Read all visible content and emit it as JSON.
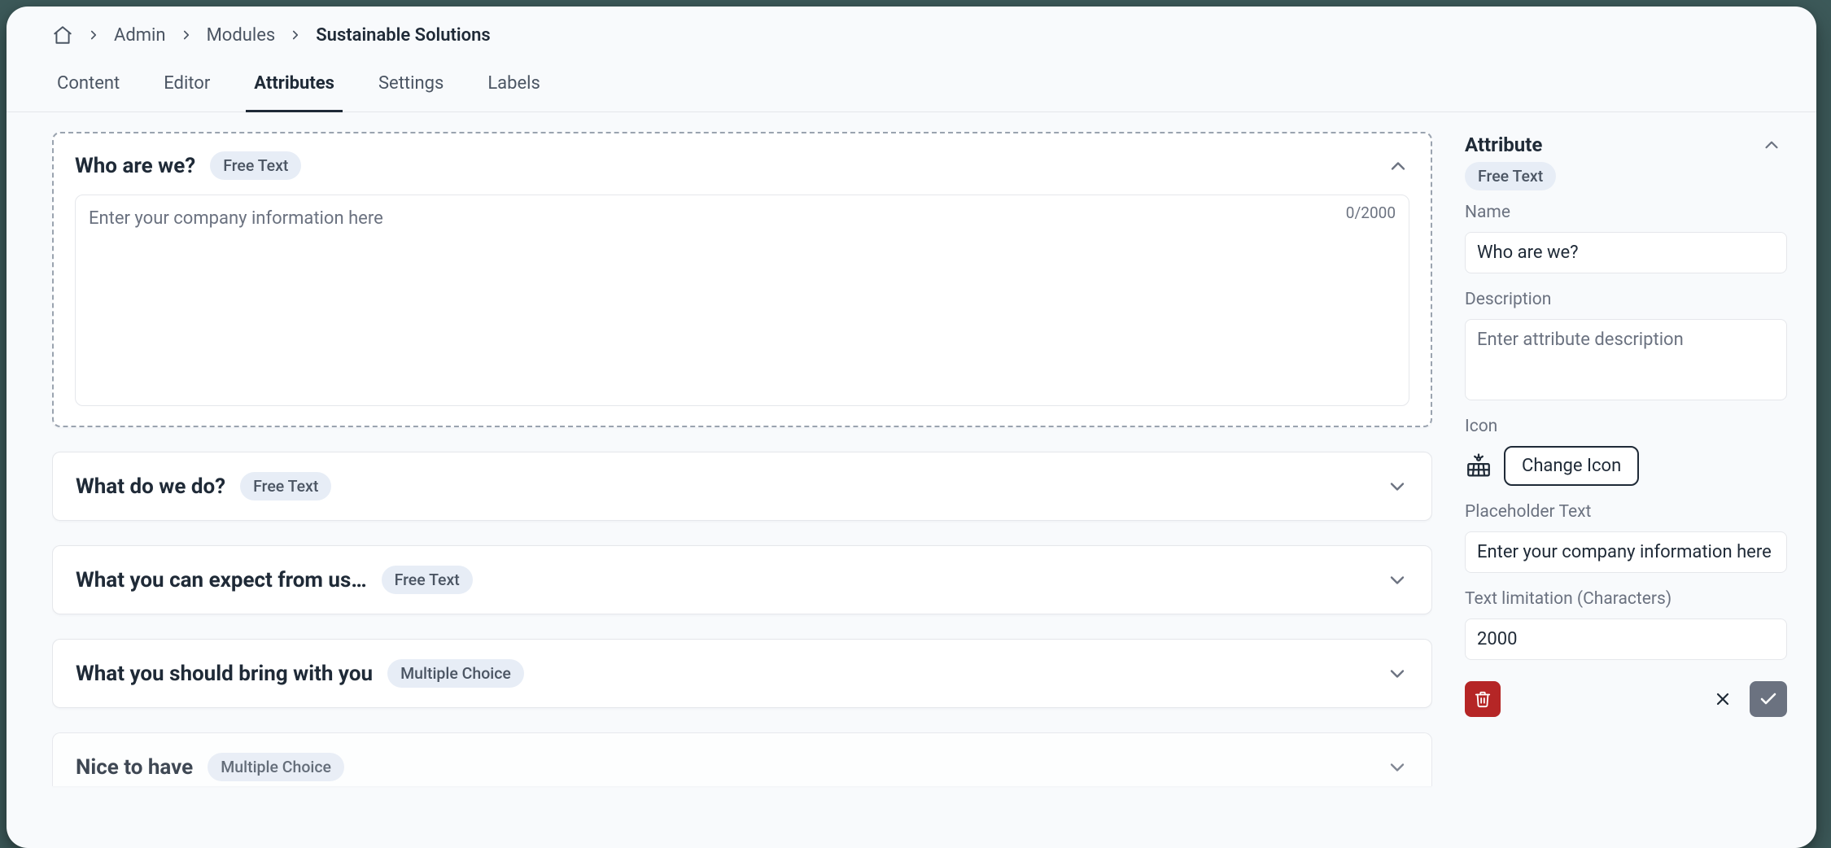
{
  "breadcrumbs": {
    "items": [
      {
        "label": "Admin"
      },
      {
        "label": "Modules"
      },
      {
        "label": "Sustainable Solutions"
      }
    ]
  },
  "tabs": [
    {
      "label": "Content",
      "active": false
    },
    {
      "label": "Editor",
      "active": false
    },
    {
      "label": "Attributes",
      "active": true
    },
    {
      "label": "Settings",
      "active": false
    },
    {
      "label": "Labels",
      "active": false
    }
  ],
  "attributes": [
    {
      "title": "Who are we?",
      "type": "Free Text",
      "expanded": true,
      "placeholder": "Enter your company information here",
      "counter": "0/2000"
    },
    {
      "title": "What do we do?",
      "type": "Free Text",
      "expanded": false
    },
    {
      "title": "What you can expect from us…",
      "type": "Free Text",
      "expanded": false
    },
    {
      "title": "What you should bring with you",
      "type": "Multiple Choice",
      "expanded": false
    },
    {
      "title": "Nice to have",
      "type": "Multiple Choice",
      "expanded": false,
      "cutoff": true
    }
  ],
  "side": {
    "heading": "Attribute",
    "type_chip": "Free Text",
    "name_label": "Name",
    "name_value": "Who are we?",
    "description_label": "Description",
    "description_placeholder": "Enter attribute description",
    "icon_label": "Icon",
    "change_icon_label": "Change Icon",
    "placeholder_label": "Placeholder Text",
    "placeholder_value": "Enter your company information here",
    "limit_label": "Text limitation (Characters)",
    "limit_value": "2000"
  }
}
